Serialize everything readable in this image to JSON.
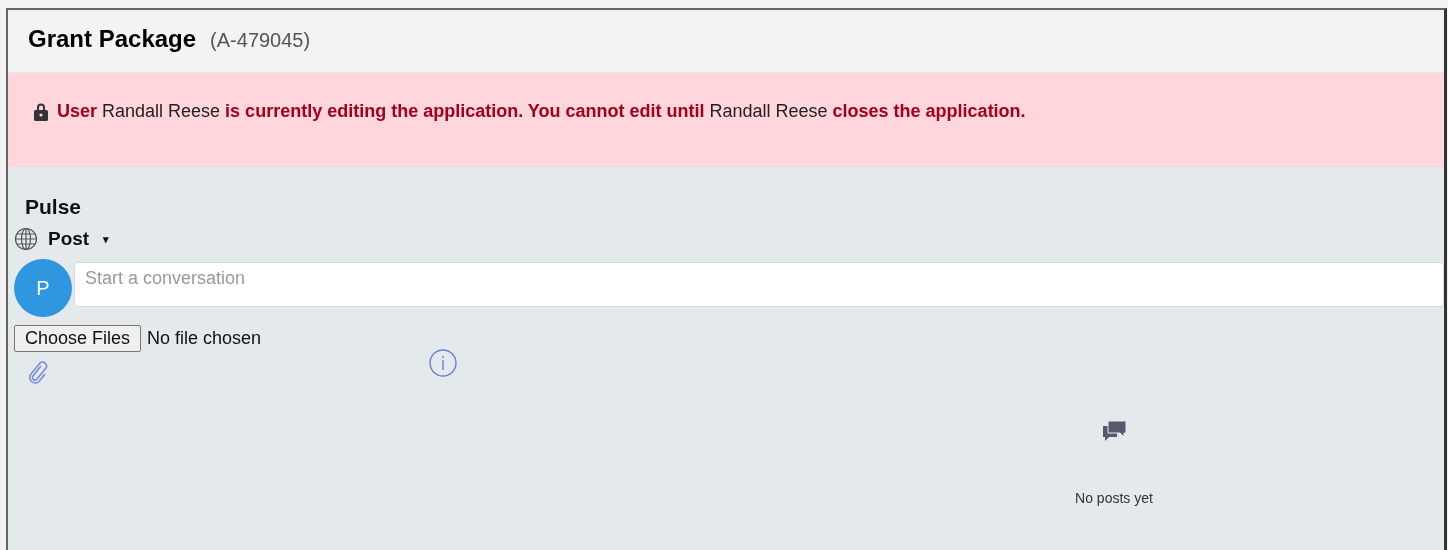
{
  "header": {
    "title": "Grant Package",
    "record_id": "(A-479045)"
  },
  "lock_banner": {
    "message": "**User** Randall Reese **is currently editing the application. You cannot edit until** Randall Reese **closes the application.**"
  },
  "pulse": {
    "title": "Pulse",
    "post_menu": {
      "label": "Post",
      "caret": "▾"
    },
    "avatar_initial": "P",
    "composer": {
      "placeholder": "Start a conversation"
    },
    "file_input": {
      "button": "Choose Files",
      "status": "No file chosen"
    },
    "empty_state": "No posts yet"
  }
}
